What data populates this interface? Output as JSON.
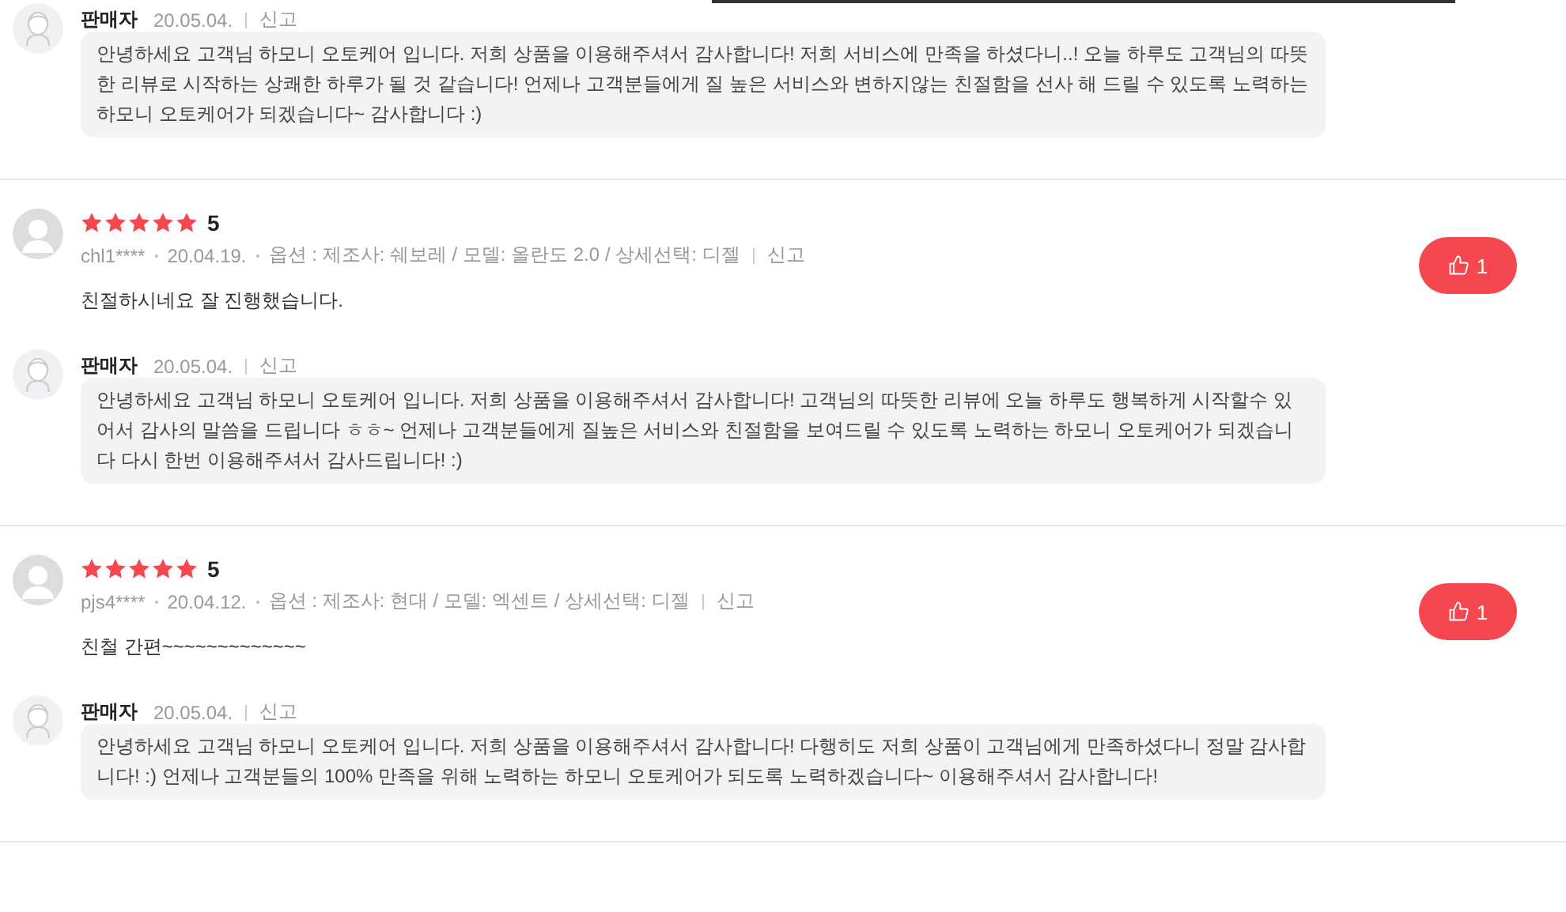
{
  "entries": [
    {
      "kind": "reply",
      "reply": {
        "author": "판매자",
        "date": "20.05.04.",
        "report": "신고",
        "text": "안녕하세요 고객님 하모니 오토케어 입니다. 저희 상품을 이용해주셔서 감사합니다! 저희 서비스에 만족을 하셨다니..! 오늘 하루도 고객님의 따뜻한 리뷰로 시작하는 상쾌한 하루가 될 것 같습니다! 언제나 고객분들에게 질 높은 서비스와 변하지않는 친절함을 선사 해 드릴 수 있도록 노력하는 하모니 오토케어가 되겠습니다~ 감사합니다 :)"
      }
    },
    {
      "kind": "review",
      "stars": 5,
      "score": "5",
      "user": "chl1****",
      "date": "20.04.19.",
      "option": "옵션 : 제조사: 쉐보레 / 모델: 올란도 2.0 / 상세선택: 디젤",
      "report": "신고",
      "body": "친절하시네요 잘 진행했습니다.",
      "likes": "1",
      "reply": {
        "author": "판매자",
        "date": "20.05.04.",
        "report": "신고",
        "text": "안녕하세요 고객님 하모니 오토케어 입니다. 저희 상품을 이용해주셔서 감사합니다! 고객님의 따뜻한 리뷰에 오늘 하루도 행복하게 시작할수 있어서 감사의 말씀을 드립니다 ㅎㅎ~ 언제나 고객분들에게 질높은 서비스와 친절함을 보여드릴 수 있도록 노력하는 하모니 오토케어가 되겠습니다 다시 한번 이용해주셔서 감사드립니다! :)"
      }
    },
    {
      "kind": "review",
      "stars": 5,
      "score": "5",
      "user": "pjs4****",
      "date": "20.04.12.",
      "option": "옵션 : 제조사: 현대 / 모델: 엑센트 / 상세선택: 디젤",
      "report": "신고",
      "body": "친철 간편~~~~~~~~~~~~~",
      "likes": "1",
      "reply": {
        "author": "판매자",
        "date": "20.05.04.",
        "report": "신고",
        "text": "안녕하세요 고객님 하모니 오토케어 입니다. 저희 상품을 이용해주셔서 감사합니다! 다행히도 저희 상품이 고객님에게 만족하셨다니 정말 감사합니다! :) 언제나 고객분들의 100% 만족을 위해 노력하는 하모니 오토케어가 되도록 노력하겠습니다~ 이용해주셔서 감사합니다!"
      }
    }
  ]
}
